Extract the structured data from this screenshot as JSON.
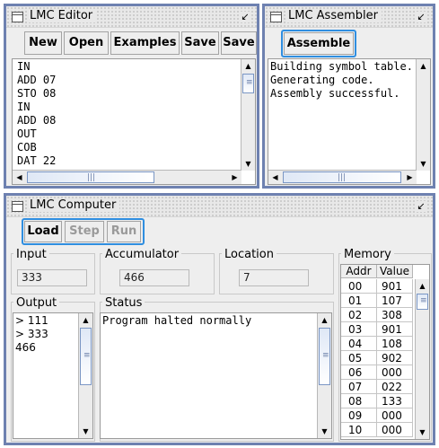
{
  "editor": {
    "title": "LMC Editor",
    "toolbar": {
      "new_label": "New",
      "open_label": "Open",
      "examples_label": "Examples",
      "save_label": "Save",
      "saveas_label": "Save"
    },
    "lines": [
      "IN",
      "ADD 07",
      "STO 08",
      "IN",
      "ADD 08",
      "OUT",
      "COB",
      "DAT 22"
    ]
  },
  "assembler": {
    "title": "LMC Assembler",
    "assemble_label": "Assemble",
    "log": [
      "Building symbol table.",
      "Generating code.",
      "Assembly successful."
    ]
  },
  "computer": {
    "title": "LMC Computer",
    "toolbar": {
      "load_label": "Load",
      "step_label": "Step",
      "run_label": "Run"
    },
    "input": {
      "label": "Input",
      "value": "333"
    },
    "accumulator": {
      "label": "Accumulator",
      "value": "466"
    },
    "location": {
      "label": "Location",
      "value": "7"
    },
    "output": {
      "label": "Output",
      "lines": [
        "> 111",
        "> 333",
        "466"
      ]
    },
    "status": {
      "label": "Status",
      "text": "Program halted normally"
    },
    "memory": {
      "label": "Memory",
      "col_addr": "Addr",
      "col_value": "Value",
      "rows": [
        {
          "addr": "00",
          "value": "901"
        },
        {
          "addr": "01",
          "value": "107"
        },
        {
          "addr": "02",
          "value": "308"
        },
        {
          "addr": "03",
          "value": "901"
        },
        {
          "addr": "04",
          "value": "108"
        },
        {
          "addr": "05",
          "value": "902"
        },
        {
          "addr": "06",
          "value": "000"
        },
        {
          "addr": "07",
          "value": "022"
        },
        {
          "addr": "08",
          "value": "133"
        },
        {
          "addr": "09",
          "value": "000"
        },
        {
          "addr": "10",
          "value": "000"
        }
      ]
    }
  },
  "icons": {
    "window_icon": "window-icon",
    "minimize": "minimize-icon",
    "scroll_up": "arrow-up-icon",
    "scroll_down": "arrow-down-icon",
    "scroll_left": "arrow-left-icon",
    "scroll_right": "arrow-right-icon"
  },
  "colors": {
    "desktop": "#7f8fb5",
    "window_border": "#6e81b0",
    "focus_ring": "#2f8ee0",
    "panel": "#eeeeee"
  }
}
